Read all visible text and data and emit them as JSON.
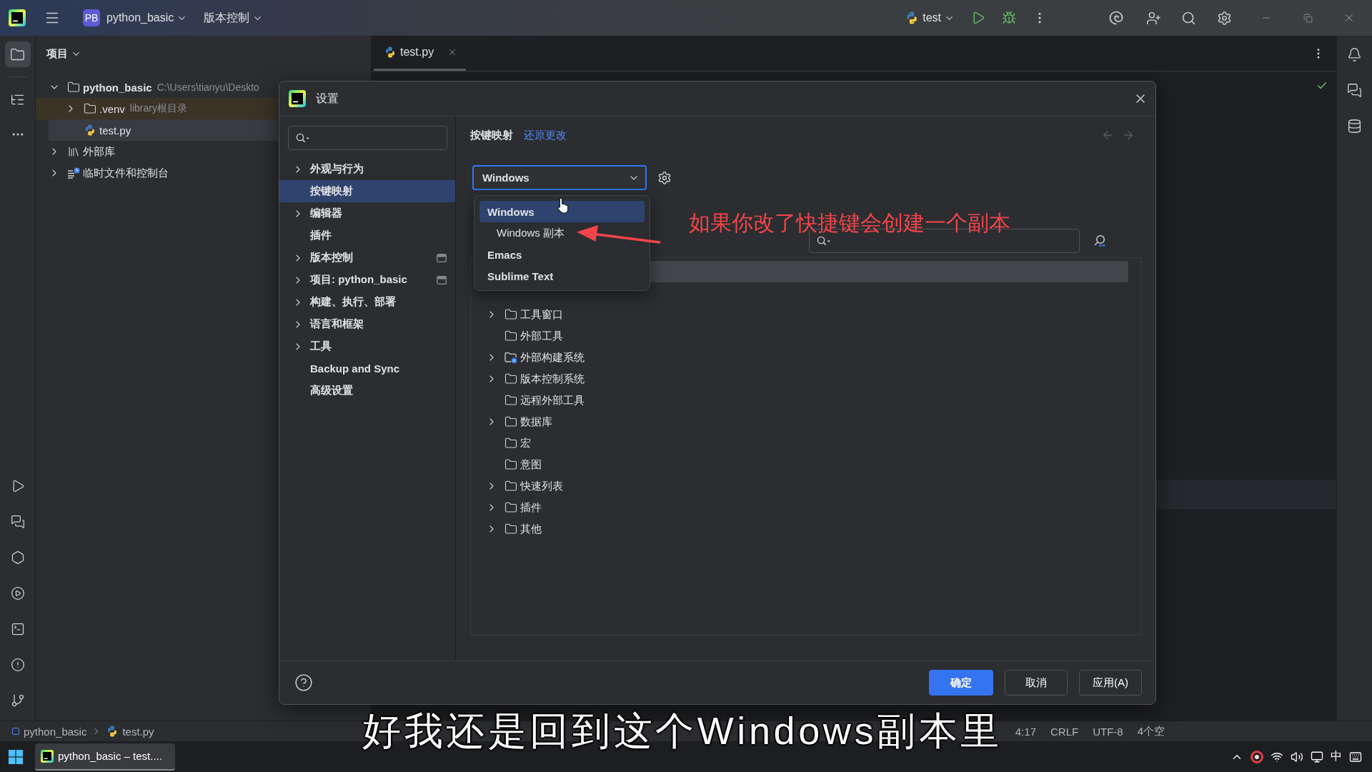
{
  "title_bar": {
    "project_badge": "PB",
    "project": "python_basic",
    "vcs_menu": "版本控制",
    "run_config": "test"
  },
  "tool_windows": [
    {
      "selected": true
    },
    {
      "selected": false
    }
  ],
  "project_panel": {
    "title": "项目",
    "tree": [
      {
        "name": "python_basic",
        "hint": "C:\\Users\\tianyu\\Deskto",
        "kind": "folder",
        "expanded": true,
        "selected": false,
        "children": [
          {
            "name": ".venv",
            "hint": "library根目录",
            "kind": "excluded_folder",
            "expanded": false,
            "selected": false
          },
          {
            "name": "test.py",
            "kind": "python_file",
            "selected": true
          }
        ]
      },
      {
        "name": "外部库",
        "kind": "library",
        "expanded": false,
        "selected": false
      },
      {
        "name": "临时文件和控制台",
        "kind": "scratches",
        "expanded": false,
        "selected": false
      }
    ]
  },
  "editor": {
    "tabs": [
      {
        "label": "test.py",
        "selected": true
      }
    ]
  },
  "settings": {
    "title": "设置",
    "sidebar": [
      {
        "label": "外观与行为",
        "expandable": true,
        "selected": false,
        "project_scope": false
      },
      {
        "label": "按键映射",
        "expandable": false,
        "selected": true,
        "project_scope": false
      },
      {
        "label": "编辑器",
        "expandable": true,
        "selected": false,
        "project_scope": false
      },
      {
        "label": "插件",
        "expandable": false,
        "selected": false,
        "project_scope": false
      },
      {
        "label": "版本控制",
        "expandable": true,
        "selected": false,
        "project_scope": true
      },
      {
        "label": "项目: python_basic",
        "expandable": true,
        "selected": false,
        "project_scope": true
      },
      {
        "label": "构建、执行、部署",
        "expandable": true,
        "selected": false,
        "project_scope": false
      },
      {
        "label": "语言和框架",
        "expandable": true,
        "selected": false,
        "project_scope": false
      },
      {
        "label": "工具",
        "expandable": true,
        "selected": false,
        "project_scope": false
      },
      {
        "label": "Backup and Sync",
        "expandable": false,
        "selected": false,
        "project_scope": false
      },
      {
        "label": "高级设置",
        "expandable": false,
        "selected": false,
        "project_scope": false
      }
    ],
    "breadcrumb": "按键映射",
    "reset_link": "还原更改",
    "back_disabled": true,
    "forward_disabled": true,
    "keymap": {
      "value": "Windows",
      "open": true,
      "options": [
        {
          "label": "Windows",
          "selected": true,
          "derived": false
        },
        {
          "label": "Windows 副本",
          "selected": false,
          "derived": true
        },
        {
          "label": "Emacs",
          "selected": false,
          "derived": false
        },
        {
          "label": "Sublime Text",
          "selected": false,
          "derived": false
        }
      ]
    },
    "actions": [
      {
        "kind": "covered",
        "selected": true
      },
      {
        "kind": "covered",
        "selected": false
      },
      {
        "label": "工具窗口",
        "kind": "folder",
        "expandable": true,
        "selected": false
      },
      {
        "label": "外部工具",
        "kind": "folder",
        "expandable": false,
        "selected": false
      },
      {
        "label": "外部构建系统",
        "kind": "build_folder",
        "expandable": true,
        "selected": false
      },
      {
        "label": "版本控制系统",
        "kind": "folder",
        "expandable": true,
        "selected": false
      },
      {
        "label": "远程外部工具",
        "kind": "folder",
        "expandable": false,
        "selected": false
      },
      {
        "label": "数据库",
        "kind": "folder",
        "expandable": true,
        "selected": false
      },
      {
        "label": "宏",
        "kind": "folder",
        "expandable": false,
        "selected": false
      },
      {
        "label": "意图",
        "kind": "folder",
        "expandable": false,
        "selected": false
      },
      {
        "label": "快速列表",
        "kind": "folder",
        "expandable": true,
        "selected": false
      },
      {
        "label": "插件",
        "kind": "folder",
        "expandable": true,
        "selected": false
      },
      {
        "label": "其他",
        "kind": "folder",
        "expandable": true,
        "selected": false
      }
    ],
    "buttons": [
      {
        "label": "确定",
        "kind": "primary"
      },
      {
        "label": "取消",
        "kind": "secondary"
      },
      {
        "label": "应用(A)",
        "kind": "secondary"
      }
    ]
  },
  "annotation": "如果你改了快捷键会创建一个副本",
  "status_bar": {
    "path": [
      "python_basic",
      "test.py"
    ],
    "position": "4:17",
    "line_separator": "CRLF",
    "encoding": "UTF-8",
    "indent": "4个空"
  },
  "subtitle": "好我还是回到这个Windows副本里",
  "taskbar": {
    "app": "python_basic – test....",
    "input_method": "中"
  }
}
